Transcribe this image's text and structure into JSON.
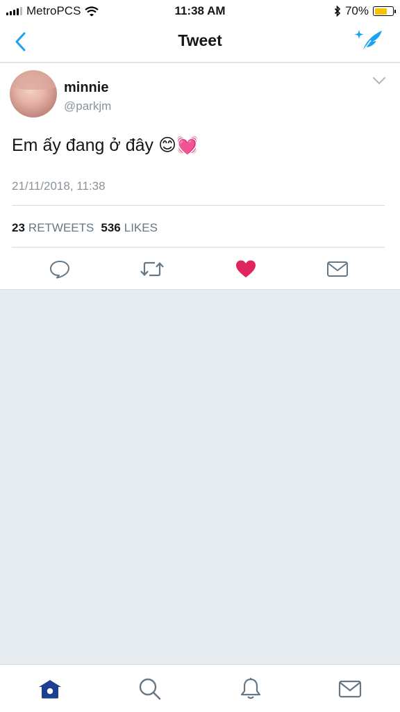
{
  "status_bar": {
    "carrier": "MetroPCS",
    "time": "11:38 AM",
    "battery_percent": "70%",
    "battery_level": 0.7,
    "icons": [
      "signal-icon",
      "wifi-icon",
      "bluetooth-icon",
      "battery-icon"
    ]
  },
  "nav": {
    "title": "Tweet",
    "back_icon": "chevron-left-icon",
    "compose_icon": "compose-tweet-icon",
    "accent_color": "#1da1f2"
  },
  "tweet": {
    "user_name": "minnie",
    "user_handle": "@parkjm",
    "text": "Em ấy đang ở đây 😊💓",
    "timestamp": "21/11/2018, 11:38",
    "retweets_count": "23",
    "retweets_label": "RETWEETS",
    "likes_count": "536",
    "likes_label": "LIKES",
    "liked": true,
    "like_color": "#e0245e"
  },
  "actions": [
    "reply-icon",
    "retweet-icon",
    "like-icon",
    "direct-message-icon"
  ],
  "tab_bar": {
    "tabs": [
      "home-icon",
      "search-icon",
      "notifications-icon",
      "messages-icon"
    ],
    "active": "home-icon",
    "active_color": "#1b3f8f"
  }
}
